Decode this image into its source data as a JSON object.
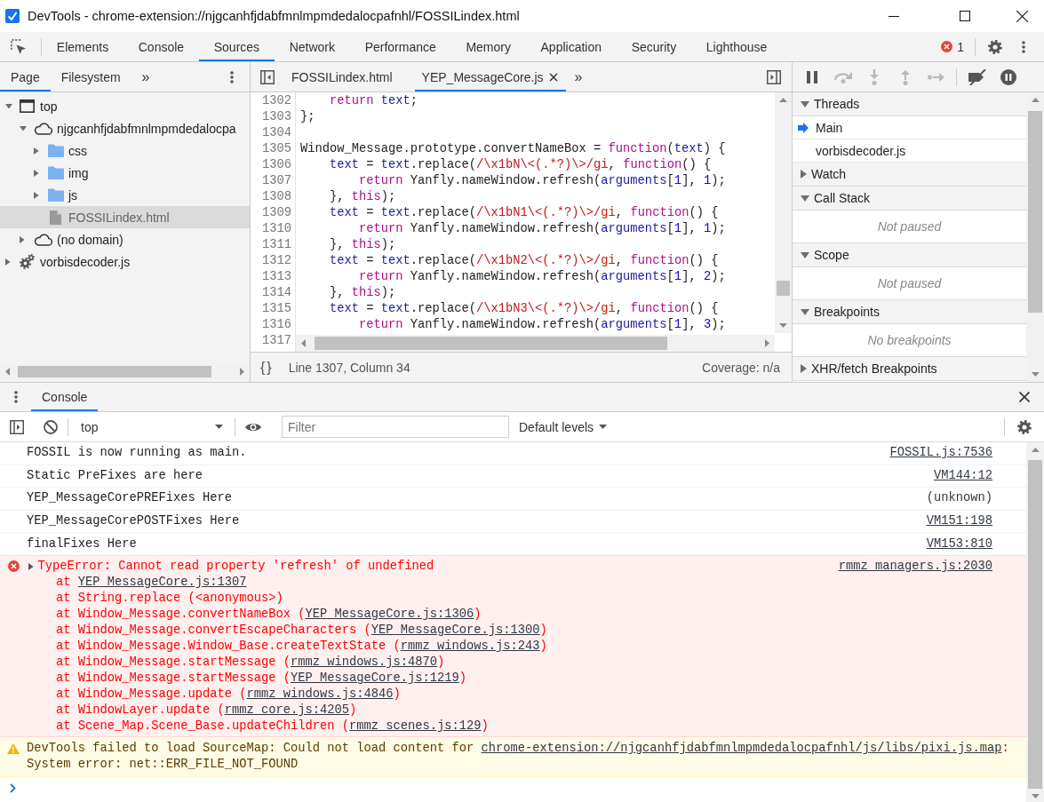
{
  "window": {
    "title": "DevTools - chrome-extension://njgcanhfjdabfmnlmpmdedalocpafnhl/FOSSILindex.html"
  },
  "main_toolbar": {
    "tabs": [
      {
        "label": "Elements",
        "selected": false
      },
      {
        "label": "Console",
        "selected": false
      },
      {
        "label": "Sources",
        "selected": true
      },
      {
        "label": "Network",
        "selected": false
      },
      {
        "label": "Performance",
        "selected": false
      },
      {
        "label": "Memory",
        "selected": false
      },
      {
        "label": "Application",
        "selected": false
      },
      {
        "label": "Security",
        "selected": false
      },
      {
        "label": "Lighthouse",
        "selected": false
      }
    ],
    "error_count": "1"
  },
  "navigator": {
    "tabs": [
      {
        "label": "Page",
        "selected": true
      },
      {
        "label": "Filesystem",
        "selected": false
      }
    ],
    "more": "»",
    "tree": [
      {
        "kind": "frame",
        "label": "top",
        "expanded": true,
        "selected": false,
        "children": [
          {
            "kind": "domain",
            "label": "njgcanhfjdabfmnlmpmdedalocpa",
            "expanded": true,
            "selected": false,
            "children": [
              {
                "kind": "folder",
                "label": "css",
                "expanded": false,
                "selected": false
              },
              {
                "kind": "folder",
                "label": "img",
                "expanded": false,
                "selected": false
              },
              {
                "kind": "folder",
                "label": "js",
                "expanded": false,
                "selected": false
              },
              {
                "kind": "file",
                "label": "FOSSILindex.html",
                "selected": true
              }
            ]
          },
          {
            "kind": "domain",
            "label": "(no domain)",
            "expanded": false,
            "selected": false
          }
        ]
      },
      {
        "kind": "worker",
        "label": "vorbisdecoder.js",
        "expanded": false,
        "selected": false
      }
    ]
  },
  "editor": {
    "tabs": [
      {
        "label": "FOSSILindex.html",
        "selected": false
      },
      {
        "label": "YEP_MessageCore.js",
        "selected": true
      }
    ],
    "more": "»",
    "lines": [
      {
        "number": "1302",
        "tokens": [
          {
            "kind": "keyword",
            "text": "    return"
          },
          {
            "kind": "variable",
            "text": " text"
          },
          {
            "kind": "plain",
            "text": ";"
          }
        ]
      },
      {
        "number": "1303",
        "tokens": [
          {
            "kind": "plain",
            "text": "};"
          }
        ]
      },
      {
        "number": "1304"
      },
      {
        "number": "1305",
        "tokens": [
          {
            "kind": "plain",
            "text": "Window_Message.prototype.convertNameBox = "
          },
          {
            "kind": "keyword",
            "text": "function"
          },
          {
            "kind": "plain",
            "text": "("
          },
          {
            "kind": "variable",
            "text": "text"
          },
          {
            "kind": "plain",
            "text": ") {"
          }
        ]
      },
      {
        "number": "1306",
        "tokens": [
          {
            "kind": "variable",
            "text": "    text"
          },
          {
            "kind": "plain",
            "text": " = "
          },
          {
            "kind": "variable",
            "text": "text"
          },
          {
            "kind": "plain",
            "text": ".replace("
          },
          {
            "kind": "regex",
            "text": "/\\x1bN\\<(.*?)\\>/gi"
          },
          {
            "kind": "plain",
            "text": ", "
          },
          {
            "kind": "keyword",
            "text": "function"
          },
          {
            "kind": "plain",
            "text": "() {"
          }
        ]
      },
      {
        "number": "1307",
        "tokens": [
          {
            "kind": "keyword",
            "text": "        return"
          },
          {
            "kind": "plain",
            "text": " Yanfly.nameWindow.refresh("
          },
          {
            "kind": "variable",
            "text": "arguments"
          },
          {
            "kind": "plain",
            "text": "["
          },
          {
            "kind": "number",
            "text": "1"
          },
          {
            "kind": "plain",
            "text": "], "
          },
          {
            "kind": "number",
            "text": "1"
          },
          {
            "kind": "plain",
            "text": ");"
          }
        ]
      },
      {
        "number": "1308",
        "tokens": [
          {
            "kind": "plain",
            "text": "    }, "
          },
          {
            "kind": "keyword",
            "text": "this"
          },
          {
            "kind": "plain",
            "text": ");"
          }
        ]
      },
      {
        "number": "1309",
        "tokens": [
          {
            "kind": "variable",
            "text": "    text"
          },
          {
            "kind": "plain",
            "text": " = "
          },
          {
            "kind": "variable",
            "text": "text"
          },
          {
            "kind": "plain",
            "text": ".replace("
          },
          {
            "kind": "regex",
            "text": "/\\x1bN1\\<(.*?)\\>/gi"
          },
          {
            "kind": "plain",
            "text": ", "
          },
          {
            "kind": "keyword",
            "text": "function"
          },
          {
            "kind": "plain",
            "text": "() {"
          }
        ]
      },
      {
        "number": "1310",
        "tokens": [
          {
            "kind": "keyword",
            "text": "        return"
          },
          {
            "kind": "plain",
            "text": " Yanfly.nameWindow.refresh("
          },
          {
            "kind": "variable",
            "text": "arguments"
          },
          {
            "kind": "plain",
            "text": "["
          },
          {
            "kind": "number",
            "text": "1"
          },
          {
            "kind": "plain",
            "text": "], "
          },
          {
            "kind": "number",
            "text": "1"
          },
          {
            "kind": "plain",
            "text": ");"
          }
        ]
      },
      {
        "number": "1311",
        "tokens": [
          {
            "kind": "plain",
            "text": "    }, "
          },
          {
            "kind": "keyword",
            "text": "this"
          },
          {
            "kind": "plain",
            "text": ");"
          }
        ]
      },
      {
        "number": "1312",
        "tokens": [
          {
            "kind": "variable",
            "text": "    text"
          },
          {
            "kind": "plain",
            "text": " = "
          },
          {
            "kind": "variable",
            "text": "text"
          },
          {
            "kind": "plain",
            "text": ".replace("
          },
          {
            "kind": "regex",
            "text": "/\\x1bN2\\<(.*?)\\>/gi"
          },
          {
            "kind": "plain",
            "text": ", "
          },
          {
            "kind": "keyword",
            "text": "function"
          },
          {
            "kind": "plain",
            "text": "() {"
          }
        ]
      },
      {
        "number": "1313",
        "tokens": [
          {
            "kind": "keyword",
            "text": "        return"
          },
          {
            "kind": "plain",
            "text": " Yanfly.nameWindow.refresh("
          },
          {
            "kind": "variable",
            "text": "arguments"
          },
          {
            "kind": "plain",
            "text": "["
          },
          {
            "kind": "number",
            "text": "1"
          },
          {
            "kind": "plain",
            "text": "], "
          },
          {
            "kind": "number",
            "text": "2"
          },
          {
            "kind": "plain",
            "text": ");"
          }
        ]
      },
      {
        "number": "1314",
        "tokens": [
          {
            "kind": "plain",
            "text": "    }, "
          },
          {
            "kind": "keyword",
            "text": "this"
          },
          {
            "kind": "plain",
            "text": ");"
          }
        ]
      },
      {
        "number": "1315",
        "tokens": [
          {
            "kind": "variable",
            "text": "    text"
          },
          {
            "kind": "plain",
            "text": " = "
          },
          {
            "kind": "variable",
            "text": "text"
          },
          {
            "kind": "plain",
            "text": ".replace("
          },
          {
            "kind": "regex",
            "text": "/\\x1bN3\\<(.*?)\\>/gi"
          },
          {
            "kind": "plain",
            "text": ", "
          },
          {
            "kind": "keyword",
            "text": "function"
          },
          {
            "kind": "plain",
            "text": "() {"
          }
        ]
      },
      {
        "number": "1316",
        "tokens": [
          {
            "kind": "keyword",
            "text": "        return"
          },
          {
            "kind": "plain",
            "text": " Yanfly.nameWindow.refresh("
          },
          {
            "kind": "variable",
            "text": "arguments"
          },
          {
            "kind": "plain",
            "text": "["
          },
          {
            "kind": "number",
            "text": "1"
          },
          {
            "kind": "plain",
            "text": "], "
          },
          {
            "kind": "number",
            "text": "3"
          },
          {
            "kind": "plain",
            "text": ");"
          }
        ]
      },
      {
        "number": "1317"
      }
    ],
    "status": {
      "format": "{}",
      "position": "Line 1307, Column 34",
      "coverage": "Coverage: n/a"
    }
  },
  "debugger": {
    "toolbar": [
      {
        "kind": "pause",
        "disabled": false
      },
      {
        "kind": "step-over",
        "disabled": true
      },
      {
        "kind": "step-into",
        "disabled": true
      },
      {
        "kind": "step-out",
        "disabled": true
      },
      {
        "kind": "step",
        "disabled": true
      },
      {
        "kind": "deactivate-breakpoints",
        "disabled": false
      },
      {
        "kind": "pause-on-exceptions",
        "disabled": false
      }
    ],
    "sections": [
      {
        "title": "Threads",
        "expanded": true,
        "items": [
          {
            "label": "Main",
            "selected": true
          },
          {
            "label": "vorbisdecoder.js",
            "selected": false
          }
        ]
      },
      {
        "title": "Watch",
        "expanded": false
      },
      {
        "title": "Call Stack",
        "expanded": true,
        "empty_text": "Not paused"
      },
      {
        "title": "Scope",
        "expanded": true,
        "empty_text": "Not paused"
      },
      {
        "title": "Breakpoints",
        "expanded": true,
        "empty_text": "No breakpoints"
      },
      {
        "title": "XHR/fetch Breakpoints",
        "expanded": false
      }
    ]
  },
  "drawer": {
    "tabs": [
      {
        "label": "Console",
        "selected": true
      }
    ],
    "console": {
      "context": "top",
      "filter": {
        "placeholder": "Filter"
      },
      "levels": "Default levels",
      "messages": [
        {
          "kind": "log",
          "text": "FOSSIL is now running as main.",
          "source": "FOSSIL.js:7536",
          "source_link": true
        },
        {
          "kind": "log",
          "text": "Static PreFixes are here",
          "source": "VM144:12",
          "source_link": true
        },
        {
          "kind": "log",
          "text": "YEP_MessageCorePREFixes Here",
          "source": "(unknown)",
          "source_link": false
        },
        {
          "kind": "log",
          "text": "YEP_MessageCorePOSTFixes Here",
          "source": "VM151:198",
          "source_link": true
        },
        {
          "kind": "log",
          "text": "finalFixes Here",
          "source": "VM153:810",
          "source_link": true
        },
        {
          "kind": "error",
          "expanded": false,
          "text": "TypeError: Cannot read property 'refresh' of undefined",
          "source": "rmmz_managers.js:2030",
          "source_link": true,
          "stack": [
            {
              "parts": [
                {
                  "text": "at ",
                  "link": false
                },
                {
                  "text": "YEP_MessageCore.js:1307",
                  "link": true
                }
              ]
            },
            {
              "parts": [
                {
                  "text": "at String.replace (<anonymous>)",
                  "link": false
                }
              ]
            },
            {
              "parts": [
                {
                  "text": "at Window_Message.convertNameBox (",
                  "link": false
                },
                {
                  "text": "YEP_MessageCore.js:1306",
                  "link": true
                },
                {
                  "text": ")",
                  "link": false
                }
              ]
            },
            {
              "parts": [
                {
                  "text": "at Window_Message.convertEscapeCharacters (",
                  "link": false
                },
                {
                  "text": "YEP_MessageCore.js:1300",
                  "link": true
                },
                {
                  "text": ")",
                  "link": false
                }
              ]
            },
            {
              "parts": [
                {
                  "text": "at Window_Message.Window_Base.createTextState (",
                  "link": false
                },
                {
                  "text": "rmmz_windows.js:243",
                  "link": true
                },
                {
                  "text": ")",
                  "link": false
                }
              ]
            },
            {
              "parts": [
                {
                  "text": "at Window_Message.startMessage (",
                  "link": false
                },
                {
                  "text": "rmmz_windows.js:4870",
                  "link": true
                },
                {
                  "text": ")",
                  "link": false
                }
              ]
            },
            {
              "parts": [
                {
                  "text": "at Window_Message.startMessage (",
                  "link": false
                },
                {
                  "text": "YEP_MessageCore.js:1219",
                  "link": true
                },
                {
                  "text": ")",
                  "link": false
                }
              ]
            },
            {
              "parts": [
                {
                  "text": "at Window_Message.update (",
                  "link": false
                },
                {
                  "text": "rmmz_windows.js:4846",
                  "link": true
                },
                {
                  "text": ")",
                  "link": false
                }
              ]
            },
            {
              "parts": [
                {
                  "text": "at WindowLayer.update (",
                  "link": false
                },
                {
                  "text": "rmmz_core.js:4205",
                  "link": true
                },
                {
                  "text": ")",
                  "link": false
                }
              ]
            },
            {
              "parts": [
                {
                  "text": "at Scene_Map.Scene_Base.updateChildren (",
                  "link": false
                },
                {
                  "text": "rmmz_scenes.js:129",
                  "link": true
                },
                {
                  "text": ")",
                  "link": false
                }
              ]
            }
          ]
        },
        {
          "kind": "warning",
          "parts": [
            {
              "text": "DevTools failed to load SourceMap: Could not load content for ",
              "link": false
            },
            {
              "text": "chrome-extension://njgcanhfjdabfmnlmpmdedalocpafnhl/js/libs/pixi.js.map",
              "link": true
            },
            {
              "text": ": System error: net::ERR_FILE_NOT_FOUND",
              "link": false
            }
          ]
        },
        {
          "kind": "prompt"
        }
      ]
    }
  }
}
